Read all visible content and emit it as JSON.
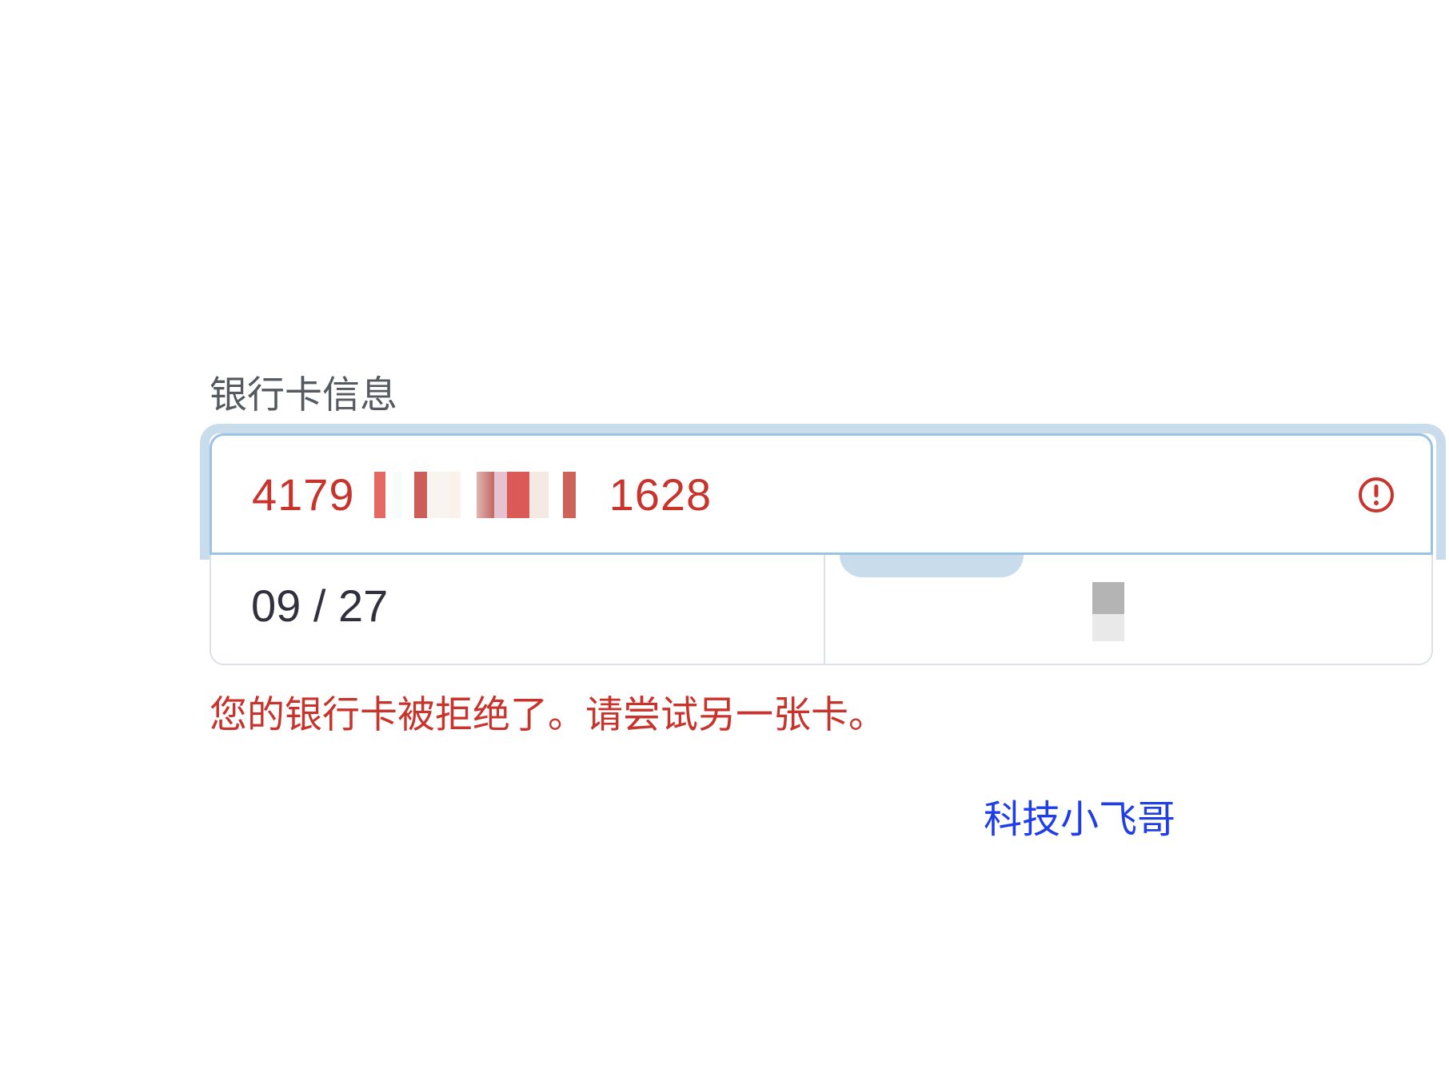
{
  "card_section": {
    "label": "银行卡信息",
    "card_number": {
      "prefix": "4179",
      "suffix": "1628",
      "state": "error",
      "obscured_middle": true
    },
    "expiry": {
      "value": "09 / 27"
    },
    "cvc": {
      "obscured": true
    },
    "error_message": "您的银行卡被拒绝了。请尝试另一张卡。"
  },
  "watermark": "科技小飞哥",
  "colors": {
    "error": "#c8332c",
    "focus_ring": "#c9dcec",
    "focus_border": "#9bc3e6",
    "label": "#555a60",
    "value_text": "#30313d",
    "watermark": "#1f3ee8"
  },
  "icons": {
    "card_number_status": "exclamation-circle-icon"
  }
}
